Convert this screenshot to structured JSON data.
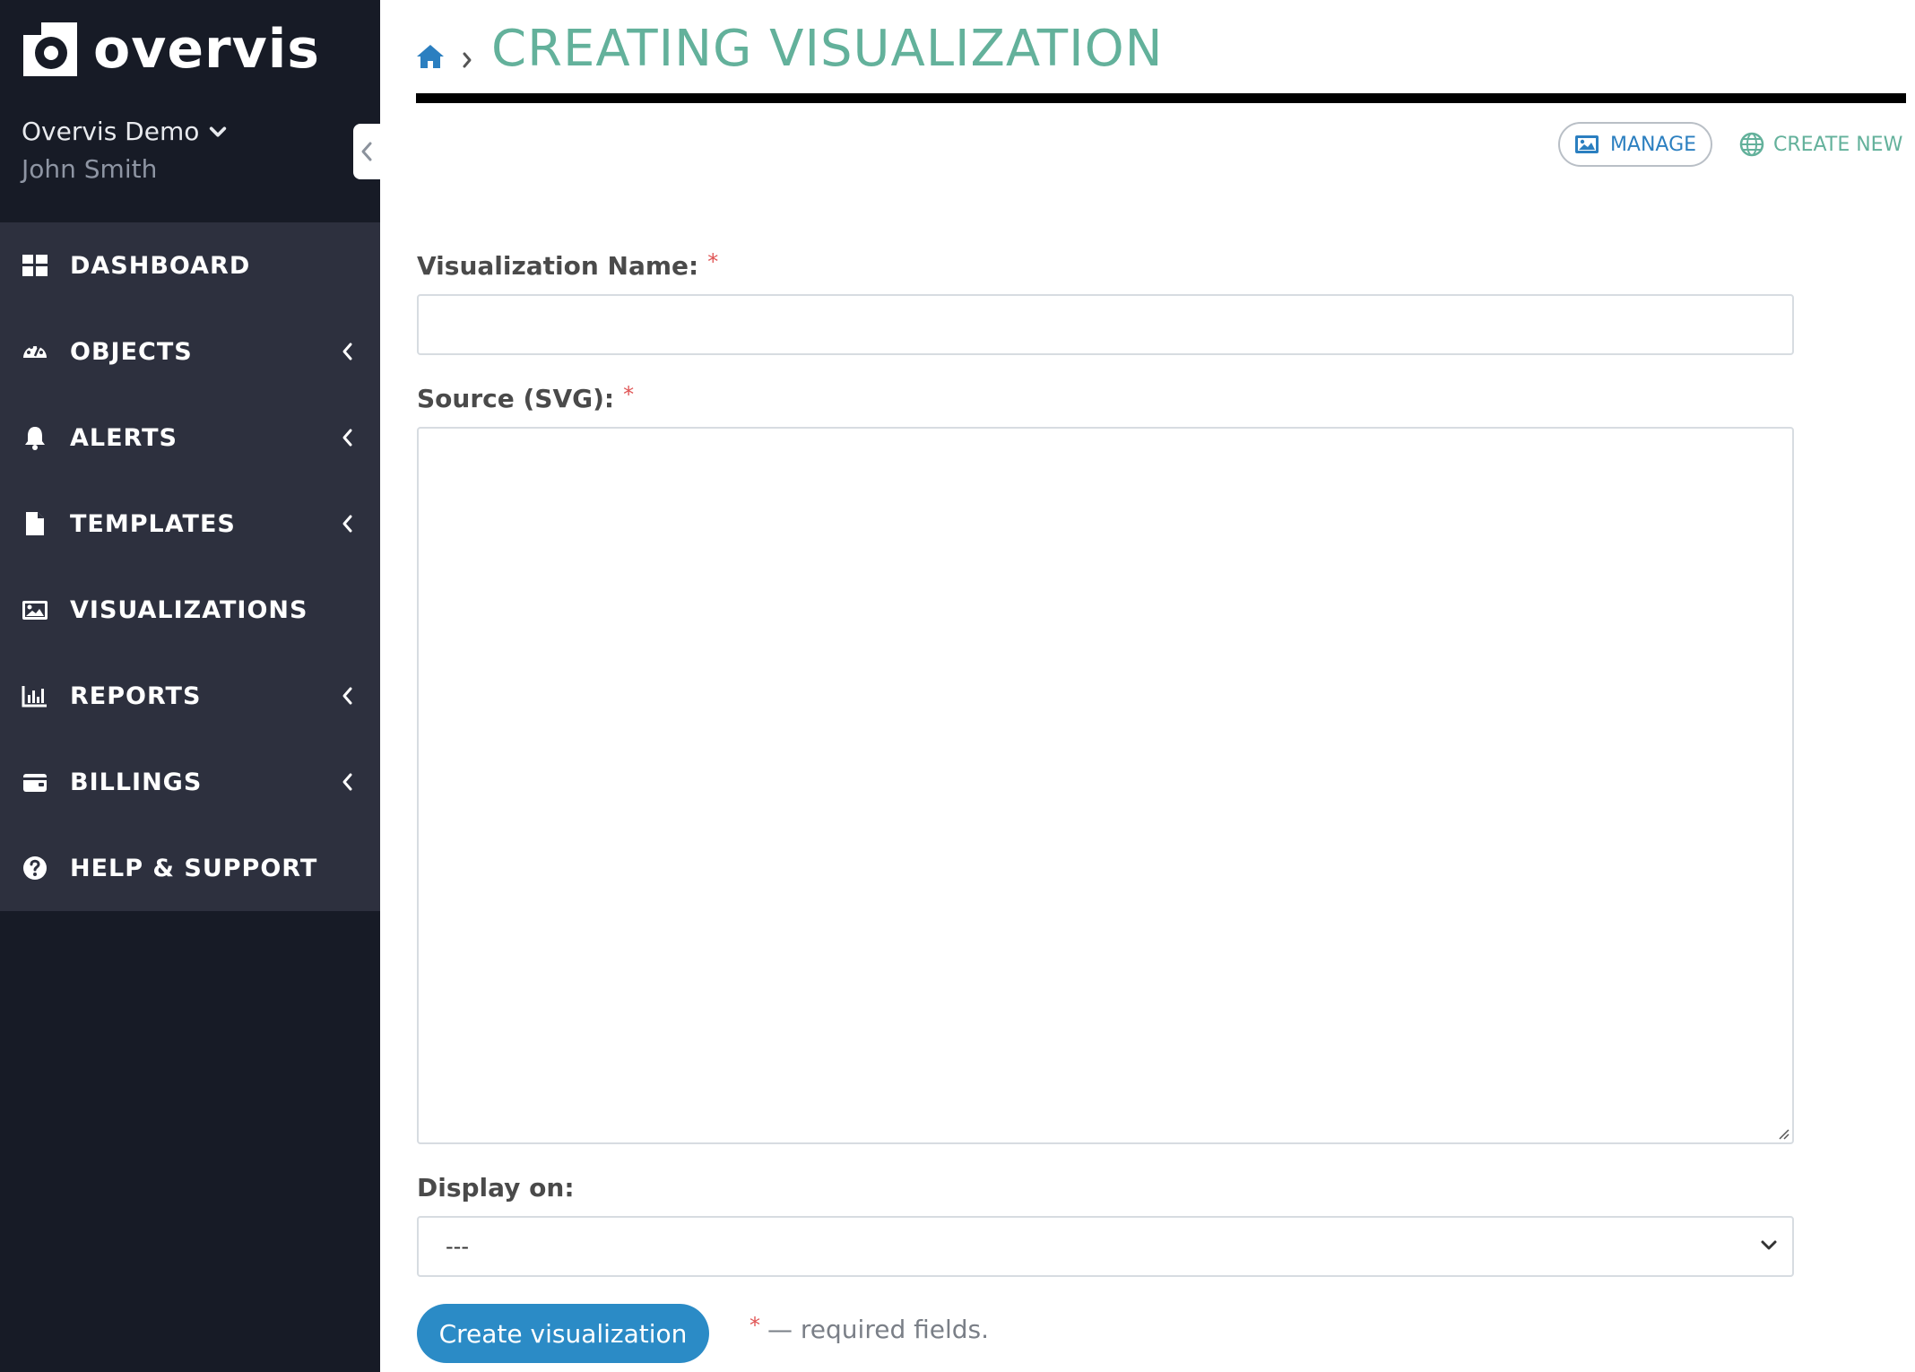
{
  "app": {
    "brand": "overvis"
  },
  "account": {
    "org": "Overvis Demo",
    "user": "John Smith"
  },
  "sidebar": {
    "items": [
      {
        "label": "DASHBOARD",
        "icon": "dashboard-icon",
        "expandable": false
      },
      {
        "label": "OBJECTS",
        "icon": "gauge-icon",
        "expandable": true
      },
      {
        "label": "ALERTS",
        "icon": "bell-icon",
        "expandable": true
      },
      {
        "label": "TEMPLATES",
        "icon": "file-icon",
        "expandable": true
      },
      {
        "label": "VISUALIZATIONS",
        "icon": "image-icon",
        "expandable": false
      },
      {
        "label": "REPORTS",
        "icon": "bar-chart-icon",
        "expandable": true
      },
      {
        "label": "BILLINGS",
        "icon": "wallet-icon",
        "expandable": true
      },
      {
        "label": "HELP & SUPPORT",
        "icon": "help-icon",
        "expandable": false
      }
    ]
  },
  "header": {
    "title": "CREATING VISUALIZATION"
  },
  "actions": {
    "manage": "MANAGE",
    "create_new": "CREATE NEW"
  },
  "form": {
    "name_label": "Visualization Name:",
    "name_value": "",
    "source_label": "Source (SVG):",
    "source_value": "",
    "display_label": "Display on:",
    "display_value": "---",
    "required_mark": "*",
    "submit": "Create visualization",
    "required_note": "— required fields."
  },
  "colors": {
    "sidebar_bg": "#171b26",
    "menu_bg": "#2d303e",
    "title": "#63b19b",
    "primary": "#2b8bc6",
    "required": "#e05555"
  }
}
